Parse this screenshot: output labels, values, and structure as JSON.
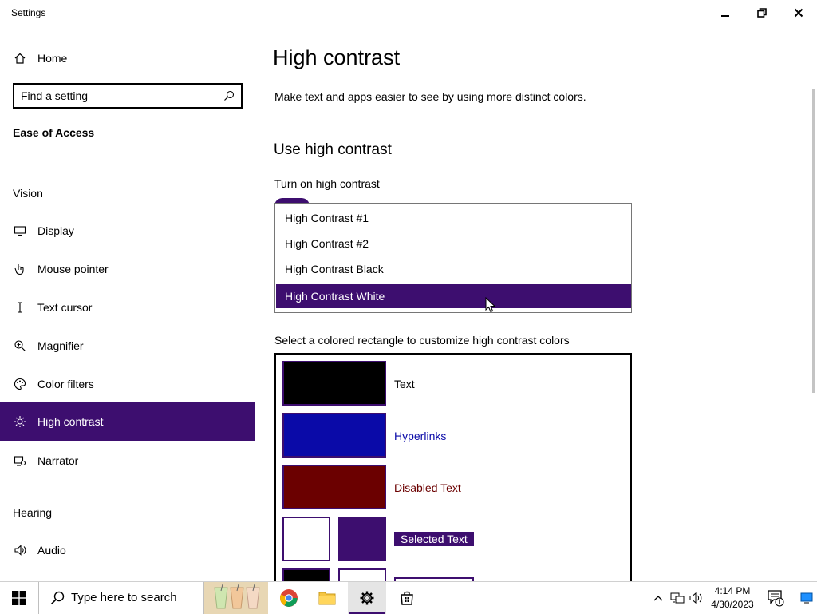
{
  "window": {
    "title": "Settings"
  },
  "sidebar": {
    "home_label": "Home",
    "search_placeholder": "Find a setting",
    "category": "Ease of Access",
    "vision_header": "Vision",
    "items": [
      {
        "label": "Display",
        "icon": "monitor-icon"
      },
      {
        "label": "Mouse pointer",
        "icon": "mouse-pointer-icon"
      },
      {
        "label": "Text cursor",
        "icon": "text-cursor-icon"
      },
      {
        "label": "Magnifier",
        "icon": "magnifier-icon"
      },
      {
        "label": "Color filters",
        "icon": "palette-icon"
      },
      {
        "label": "High contrast",
        "icon": "sun-icon",
        "selected": true
      },
      {
        "label": "Narrator",
        "icon": "narrator-icon"
      }
    ],
    "hearing_header": "Hearing",
    "hearing_items": [
      {
        "label": "Audio",
        "icon": "speaker-icon"
      }
    ]
  },
  "main": {
    "title": "High contrast",
    "description": "Make text and apps easier to see by using more distinct colors.",
    "section_heading": "Use high contrast",
    "toggle_label": "Turn on high contrast",
    "theme_options": [
      "High Contrast #1",
      "High Contrast #2",
      "High Contrast Black",
      "High Contrast White"
    ],
    "selected_theme": "High Contrast White",
    "colors_label": "Select a colored rectangle to customize high contrast colors",
    "colors": {
      "text": {
        "label": "Text",
        "color": "#000000"
      },
      "hyperlinks": {
        "label": "Hyperlinks",
        "color": "#0a0aa8"
      },
      "disabled_text": {
        "label": "Disabled Text",
        "color": "#6b0000"
      },
      "selected_text": {
        "label": "Selected Text",
        "fg": "#ffffff",
        "bg": "#3d0e6f"
      }
    }
  },
  "accent_color": "#3d0e6f",
  "taskbar": {
    "search_placeholder": "Type here to search",
    "time": "4:14 PM",
    "date": "4/30/2023",
    "notification_count": "1"
  }
}
